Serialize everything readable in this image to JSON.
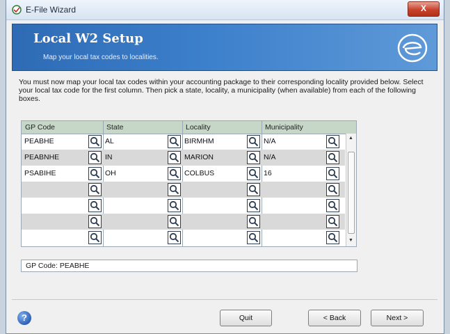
{
  "window": {
    "title": "E-File Wizard",
    "close_label": "X"
  },
  "header": {
    "title": "Local W2 Setup",
    "subtitle": "Map your local tax codes to localities."
  },
  "instructions": "You must now map your local tax codes within your accounting package to their corresponding locality provided below.  Select your local tax code for the first column.  Then pick a state, locality, a municipality (when available) from each of the following boxes.",
  "grid": {
    "columns": [
      "GP Code",
      "State",
      "Locality",
      "Municipality"
    ],
    "rows": [
      [
        "PEABHE",
        "AL",
        "BIRMHM",
        "N/A"
      ],
      [
        "PEABNHE",
        "IN",
        "MARION",
        "N/A"
      ],
      [
        "PSABIHE",
        "OH",
        "COLBUS",
        "16"
      ],
      [
        "",
        "",
        "",
        ""
      ],
      [
        "",
        "",
        "",
        ""
      ],
      [
        "",
        "",
        "",
        ""
      ],
      [
        "",
        "",
        "",
        ""
      ]
    ]
  },
  "status": "GP Code: PEABHE",
  "buttons": {
    "quit": "Quit",
    "back": "< Back",
    "next": "Next >",
    "help": "?"
  }
}
